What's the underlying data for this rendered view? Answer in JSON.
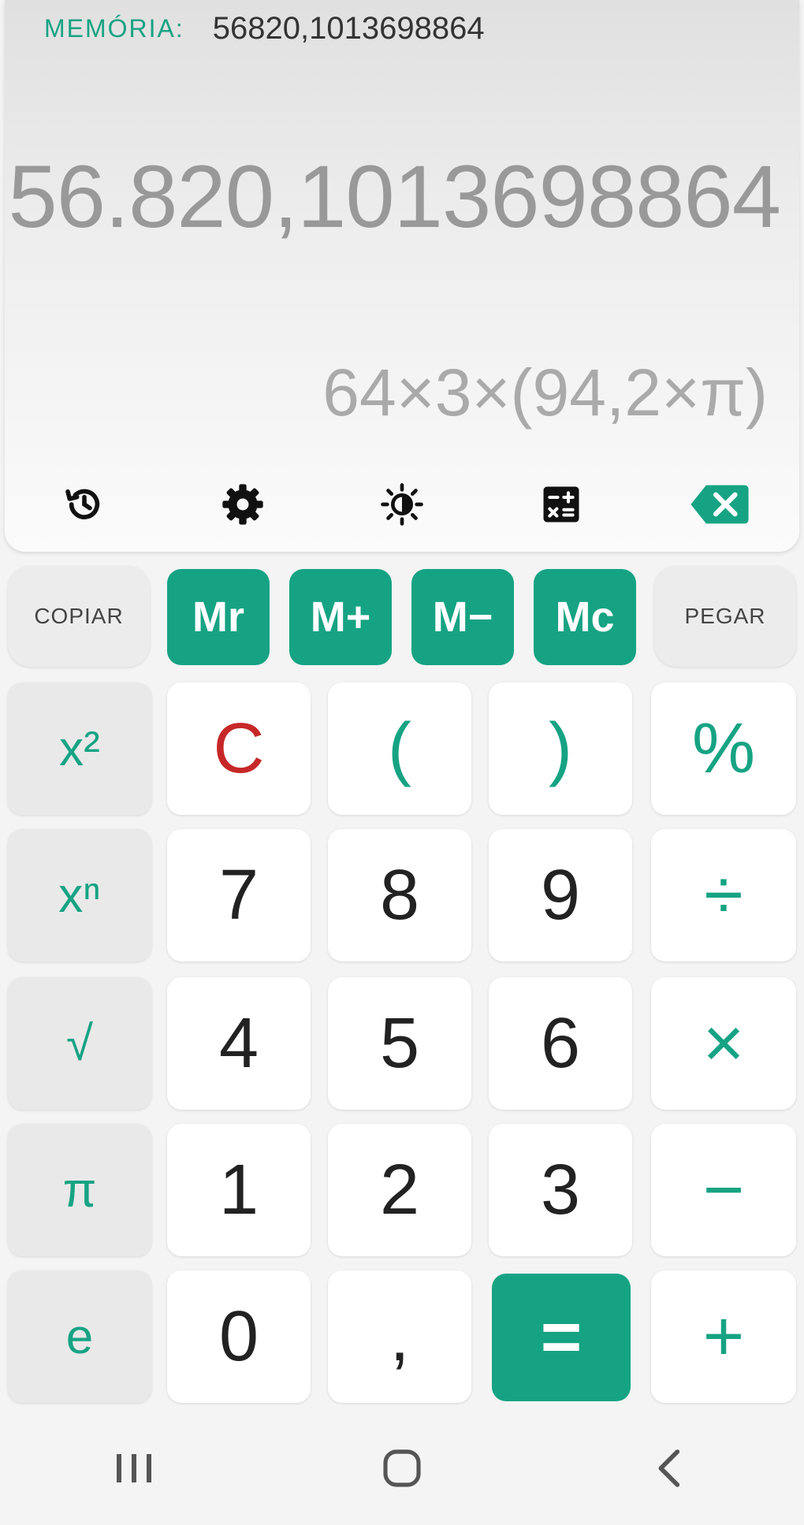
{
  "display": {
    "memory_label": "MEMÓRIA:",
    "memory_value": "56820,1013698864",
    "result": "56.820,1013698864",
    "expression": "64×3×(94,2×π)"
  },
  "toolbar": {
    "icons": [
      "history-icon",
      "gear-icon",
      "brightness-icon",
      "calculator-layout-icon",
      "backspace-icon"
    ]
  },
  "memory_row": {
    "copy": "COPIAR",
    "recall": "Mr",
    "add": "M+",
    "subtract": "M−",
    "clear": "Mc",
    "paste": "PEGAR"
  },
  "keys": {
    "square": "x²",
    "clear": "C",
    "open_paren": "(",
    "close_paren": ")",
    "percent": "%",
    "power": "xⁿ",
    "seven": "7",
    "eight": "8",
    "nine": "9",
    "divide": "÷",
    "sqrt": "√",
    "four": "4",
    "five": "5",
    "six": "6",
    "multiply": "×",
    "pi": "π",
    "one": "1",
    "two": "2",
    "three": "3",
    "minus": "−",
    "e": "e",
    "zero": "0",
    "comma": ",",
    "equals": "=",
    "plus": "+"
  },
  "colors": {
    "accent": "#16a383",
    "clear": "#c62828"
  }
}
